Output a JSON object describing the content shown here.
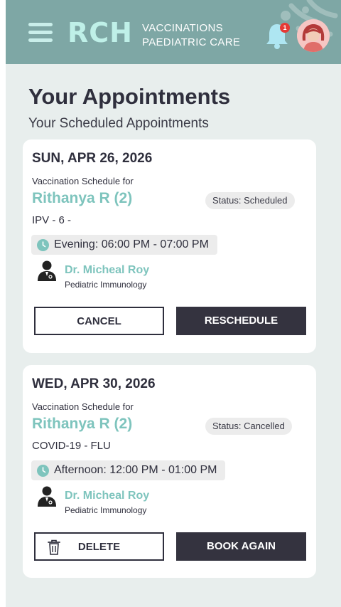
{
  "header": {
    "logo": "RCH",
    "tagline_line1": "VACCINATIONS",
    "tagline_line2": "PAEDIATRIC CARE",
    "notification_count": "1",
    "header_color": "#7ea7a5",
    "accent": "#7ec4bd"
  },
  "page": {
    "title": "Your Appointments",
    "subtitle": "Your Scheduled Appointments"
  },
  "appointments": [
    {
      "date": "SUN, APR 26, 2026",
      "for_label": "Vaccination Schedule for",
      "patient": "Rithanya R (2)",
      "status": "Status: Scheduled",
      "vaccine": "IPV - 6 -",
      "time_slot": "Evening: 06:00 PM - 07:00 PM",
      "doctor": "Dr. Micheal Roy",
      "specialty": "Pediatric Immunology",
      "primary_action": "CANCEL",
      "secondary_action": "RESCHEDULE"
    },
    {
      "date": "WED, APR 30, 2026",
      "for_label": "Vaccination Schedule for",
      "patient": "Rithanya R (2)",
      "status": "Status: Cancelled",
      "vaccine": "COVID-19 - FLU",
      "time_slot": "Afternoon: 12:00 PM - 01:00 PM",
      "doctor": "Dr. Micheal Roy",
      "specialty": "Pediatric Immunology",
      "primary_action": "DELETE",
      "secondary_action": "BOOK AGAIN"
    }
  ],
  "icons": [
    "menu-icon",
    "bell-icon",
    "avatar",
    "clock-icon",
    "doctor-icon",
    "trash-icon"
  ]
}
